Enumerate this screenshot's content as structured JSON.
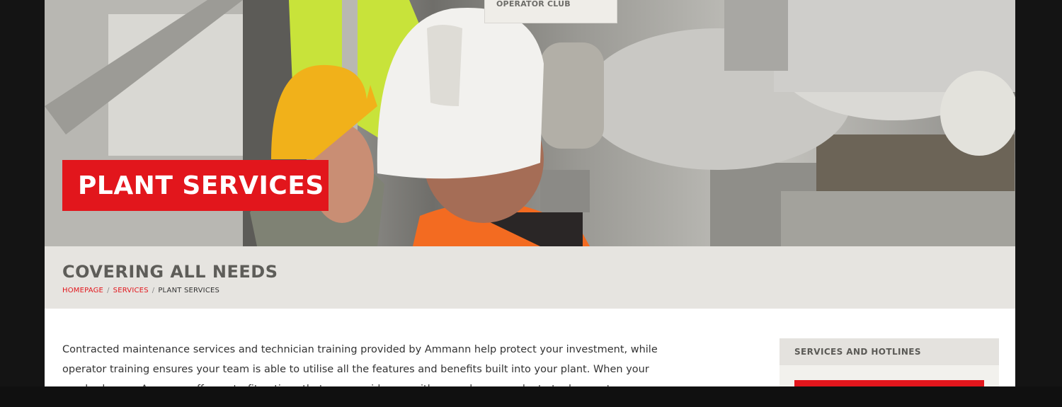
{
  "nav": {
    "dropdown_item": "OPERATOR CLUB"
  },
  "hero": {
    "title": "PLANT SERVICES"
  },
  "page": {
    "heading": "COVERING ALL NEEDS",
    "breadcrumbs": [
      "HOMEPAGE",
      "SERVICES",
      "PLANT SERVICES"
    ]
  },
  "content": {
    "lines": [
      "Contracted maintenance services and technician training provided by Ammann help protect your investment, while",
      "operator training ensures your team is able to utilise all the features and benefits built into your plant. When your",
      "needs change, Ammann offers retrofit options that can provide you with a good-as-new plant at a low cost."
    ]
  },
  "sidebar": {
    "heading": "SERVICES AND HOTLINES"
  },
  "colors": {
    "accent": "#e2161c",
    "band": "#e6e4e0",
    "frame": "#141414"
  }
}
